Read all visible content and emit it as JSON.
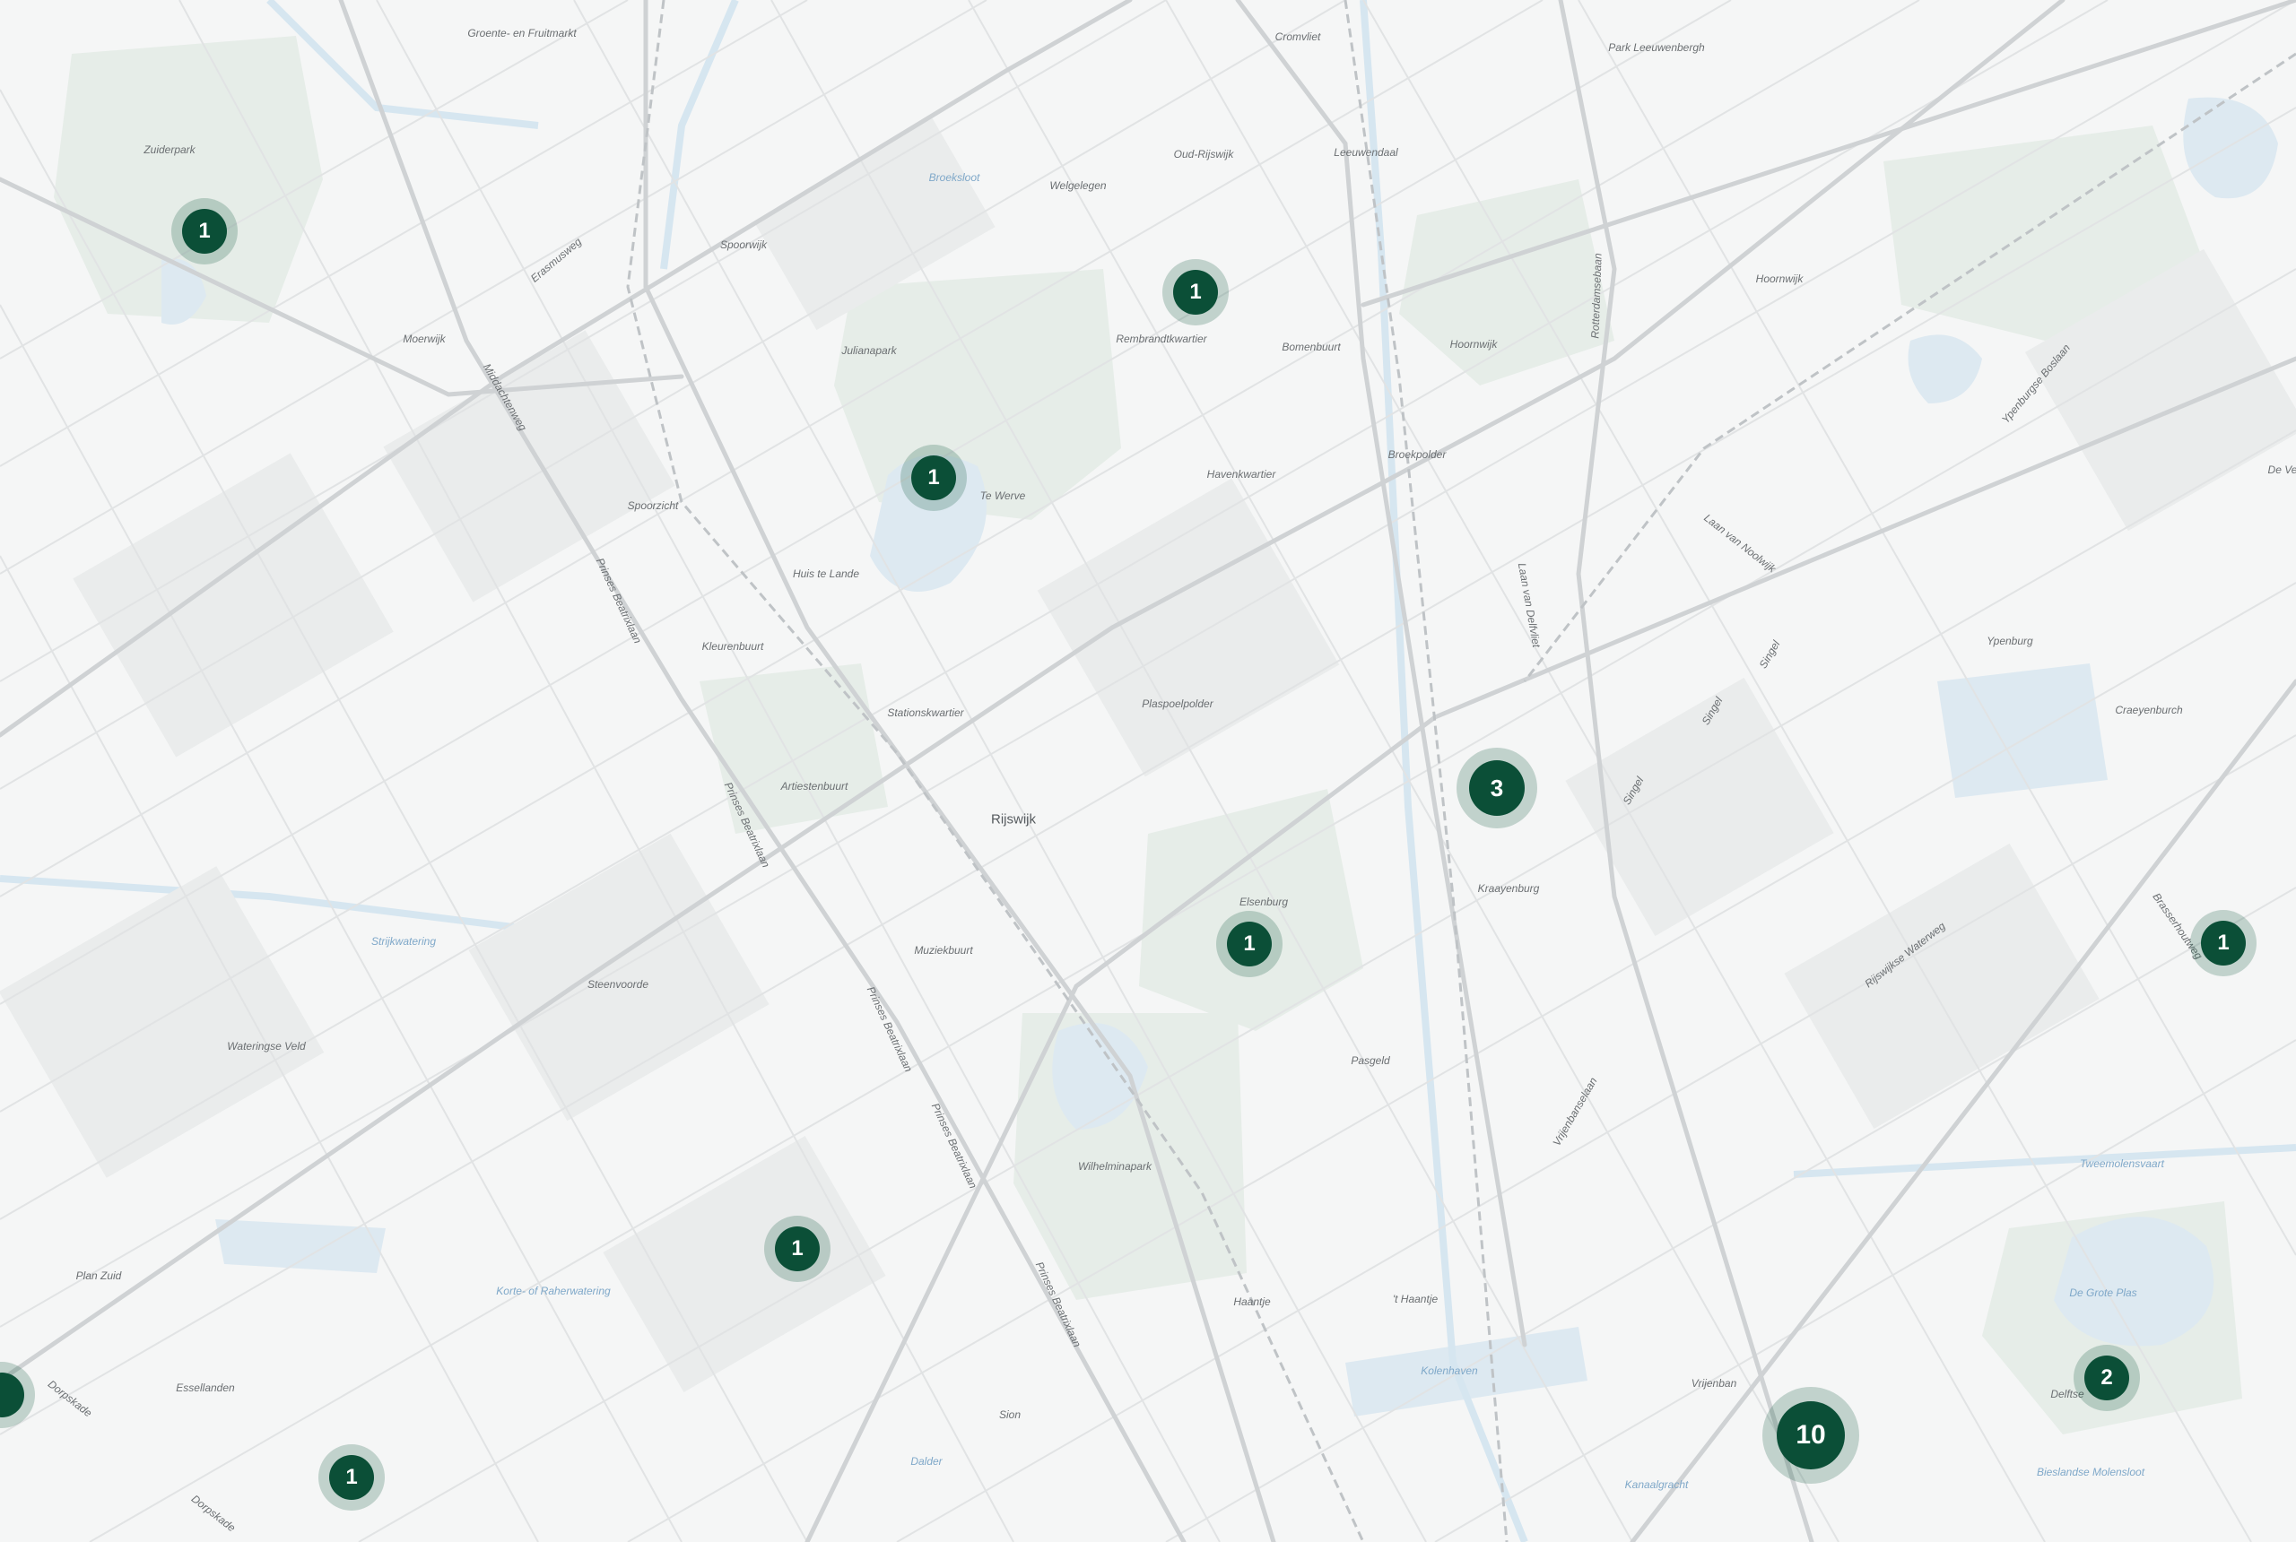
{
  "colors": {
    "cluster": "#0b4f37",
    "water": "#dceaf3",
    "park": "#e4ece6",
    "road": "#d2d4d6",
    "background": "#f6f7f7"
  },
  "clusters": [
    {
      "id": "c1",
      "count": "1",
      "size": "s"
    },
    {
      "id": "c2",
      "count": "1",
      "size": "s"
    },
    {
      "id": "c3",
      "count": "1",
      "size": "s"
    },
    {
      "id": "c4",
      "count": "3",
      "size": "m"
    },
    {
      "id": "c5",
      "count": "1",
      "size": "s"
    },
    {
      "id": "c6",
      "count": "1",
      "size": "s"
    },
    {
      "id": "c7",
      "count": "1",
      "size": "s"
    },
    {
      "id": "c8",
      "count": "1",
      "size": "s"
    },
    {
      "id": "c9",
      "count": "2",
      "size": "s"
    },
    {
      "id": "c10",
      "count": "10",
      "size": "l"
    }
  ],
  "labels": {
    "groente": "Groente- en Fruitmarkt",
    "cromvliet": "Cromvliet",
    "park_leeuwenbergh": "Park Leeuwenbergh",
    "zuiderpark": "Zuiderpark",
    "oud_rijswijk": "Oud-Rijswijk",
    "leeuwendaal": "Leeuwendaal",
    "broeksloot": "Broeksloot",
    "welgelegen": "Welgelegen",
    "spoorwijk": "Spoorwijk",
    "hoornwijk_n": "Hoornwijk",
    "erasmusweg_1": "Erasmusweg",
    "moerwijk": "Moerwijk",
    "julianapark": "Julianapark",
    "rembrandtkwartier": "Rembrandtkwartier",
    "bomenbuurt": "Bomenbuurt",
    "hoornwijk": "Hoornwijk",
    "rotterdamsebaan_1": "Rotterdamsebaan",
    "ypenburgse_boslaan_1": "Ypenburgse Boslaan",
    "broekpolder": "Broekpolder",
    "havenkwartier": "Havenkwartier",
    "te_werve": "Te Werve",
    "spoorzicht": "Spoorzicht",
    "huis_te_lande": "Huis te Lande",
    "kleurenbuurt": "Kleurenbuurt",
    "stationskwartier": "Stationskwartier",
    "plaspoelpolder": "Plaspoelpolder",
    "laan_van_nooitgedacht": "Laan van Noolwijk",
    "ypenburg": "Ypenburg",
    "craeyenburch": "Craeyenburch",
    "artiestenbuurt": "Artiestenbuurt",
    "rijswijk": "Rijswijk",
    "elsenburg": "Elsenburg",
    "kraayenburg": "Kraayenburg",
    "muziekbuurt": "Muziekbuurt",
    "steenvoorde": "Steenvoorde",
    "strijkwatering": "Strijkwatering",
    "wateringse_veld": "Wateringse Veld",
    "pasgeld": "Pasgeld",
    "wilhelminapark": "Wilhelminapark",
    "plan_zuid": "Plan Zuid",
    "korte_raherwatering": "Korte- of Raherwatering",
    "haantje": "Haantje",
    "t_haantje": "'t Haantje",
    "kolenhaven": "Kolenhaven",
    "vrijenban": "Vrijenban",
    "de_grote_plas": "De Grote Plas",
    "delftse_hout": "Delftse",
    "tweemolensvaart": "Tweemolensvaart",
    "biesland": "Bieslandse Molensloot",
    "kantoorgracht": "Kanaalgracht",
    "esselanden": "Essellanden",
    "dorpskade_1": "Dorpskade",
    "dorpskade_2": "Dorpskade",
    "sion": "Sion",
    "dalder": "Dalder",
    "prinses_beatrixlaan_1": "Prinses Beatrixlaan",
    "prinses_beatrixlaan_2": "Prinses Beatrixlaan",
    "prinses_beatrixlaan_3": "Prinses Beatrixlaan",
    "prinses_beatrixlaan_4": "Prinses Beatrixlaan",
    "prinses_beatrixlaan_5": "Prinses Beatrixlaan",
    "middachtenweg": "Middachtenweg",
    "singel_1": "Singel",
    "singel_2": "Singel",
    "singel_3": "Singel",
    "rijswijkse_waterweg": "Rijswijkse Waterweg",
    "brassershoutweg": "Brasserhoutweg",
    "vrijenbanselaan": "Vrijenbanselaan",
    "laan_van_delfvliet": "Laan van Delfvliet",
    "de_ve": "De Ve"
  }
}
